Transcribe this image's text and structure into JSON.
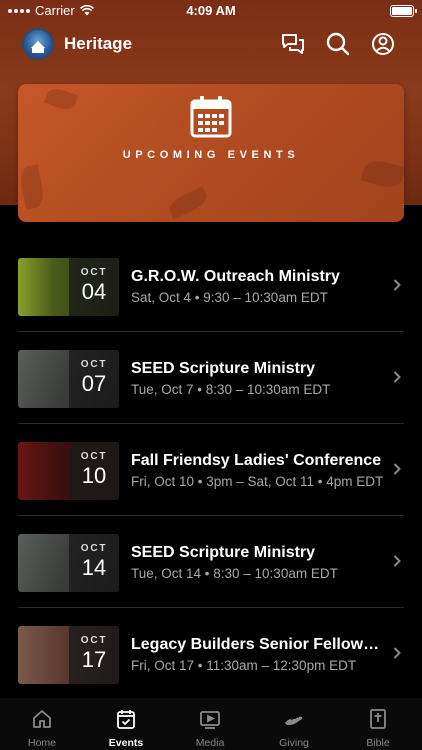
{
  "status_bar": {
    "carrier": "Carrier",
    "time": "4:09 AM"
  },
  "header": {
    "title": "Heritage",
    "icons": [
      "chat-icon",
      "search-icon",
      "profile-icon"
    ]
  },
  "hero": {
    "label": "UPCOMING EVENTS",
    "icon": "calendar-icon"
  },
  "events": [
    {
      "month": "OCT",
      "day": "04",
      "title": "G.R.O.W. Outreach Ministry",
      "subtitle": "Sat, Oct 4 • 9:30 – 10:30am EDT",
      "thumb_color": "#3c4a1c"
    },
    {
      "month": "OCT",
      "day": "07",
      "title": "SEED Scripture Ministry",
      "subtitle": "Tue, Oct 7 • 8:30 – 10:30am EDT",
      "thumb_color": "#3a3d3a"
    },
    {
      "month": "OCT",
      "day": "10",
      "title": "Fall Friendsy Ladies' Conference",
      "subtitle": "Fri, Oct 10 • 3pm – Sat, Oct 11 • 4pm EDT",
      "thumb_color": "#5a1212"
    },
    {
      "month": "OCT",
      "day": "14",
      "title": "SEED Scripture Ministry",
      "subtitle": "Tue, Oct 14 • 8:30 – 10:30am EDT",
      "thumb_color": "#3a3d3a"
    },
    {
      "month": "OCT",
      "day": "17",
      "title": "Legacy Builders Senior Fellowship",
      "subtitle": "Fri, Oct 17 • 11:30am – 12:30pm EDT",
      "thumb_color": "#5a3a30"
    }
  ],
  "tabs": [
    {
      "label": "Home",
      "icon": "home-icon",
      "active": false
    },
    {
      "label": "Events",
      "icon": "calendar-check-icon",
      "active": true
    },
    {
      "label": "Media",
      "icon": "play-icon",
      "active": false
    },
    {
      "label": "Giving",
      "icon": "giving-icon",
      "active": false
    },
    {
      "label": "Bible",
      "icon": "bible-icon",
      "active": false
    }
  ],
  "colors": {
    "accent_brown": "#8b3a1b",
    "hero_orange": "#c6582a",
    "background": "#000000",
    "muted_text": "#a8a8a8"
  }
}
